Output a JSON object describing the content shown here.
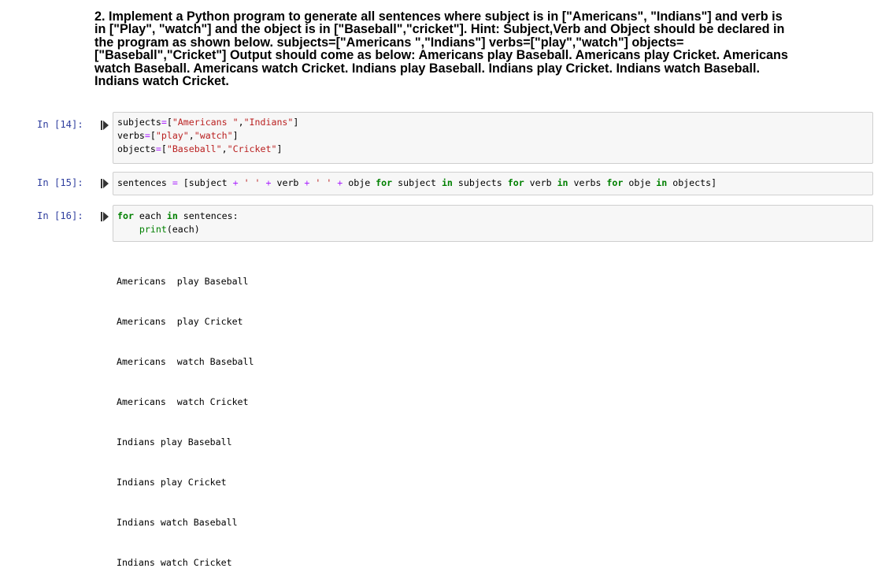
{
  "markdown": {
    "heading": "2. Implement a Python program to generate all sentences where subject is in [\"Americans\", \"Indians\"] and verb is\nin [\"Play\", \"watch\"] and the object is in [\"Baseball\",\"cricket\"]. Hint: Subject,Verb and Object should be declared in\nthe program as shown below. subjects=[\"Americans \",\"Indians\"] verbs=[\"play\",\"watch\"] objects=\n[\"Baseball\",\"Cricket\"] Output should come as below: Americans play Baseball. Americans play Cricket. Americans\nwatch Baseball. Americans watch Cricket. Indians play Baseball. Indians play Cricket. Indians watch Baseball.\nIndians watch Cricket."
  },
  "cells": [
    {
      "prompt": "In [14]:",
      "lines": [
        [
          {
            "t": "subjects",
            "c": ""
          },
          {
            "t": "=",
            "c": "op"
          },
          {
            "t": "[",
            "c": ""
          },
          {
            "t": "\"Americans \"",
            "c": "str"
          },
          {
            "t": ",",
            "c": ""
          },
          {
            "t": "\"Indians\"",
            "c": "str"
          },
          {
            "t": "]",
            "c": ""
          }
        ],
        [
          {
            "t": "verbs",
            "c": ""
          },
          {
            "t": "=",
            "c": "op"
          },
          {
            "t": "[",
            "c": ""
          },
          {
            "t": "\"play\"",
            "c": "str"
          },
          {
            "t": ",",
            "c": ""
          },
          {
            "t": "\"watch\"",
            "c": "str"
          },
          {
            "t": "]",
            "c": ""
          }
        ],
        [
          {
            "t": "objects",
            "c": ""
          },
          {
            "t": "=",
            "c": "op"
          },
          {
            "t": "[",
            "c": ""
          },
          {
            "t": "\"Baseball\"",
            "c": "str"
          },
          {
            "t": ",",
            "c": ""
          },
          {
            "t": "\"Cricket\"",
            "c": "str"
          },
          {
            "t": "]",
            "c": ""
          }
        ]
      ]
    },
    {
      "prompt": "In [15]:",
      "lines": [
        [
          {
            "t": "sentences ",
            "c": ""
          },
          {
            "t": "=",
            "c": "op"
          },
          {
            "t": " [subject ",
            "c": ""
          },
          {
            "t": "+",
            "c": "op"
          },
          {
            "t": " ",
            "c": ""
          },
          {
            "t": "' '",
            "c": "str"
          },
          {
            "t": " ",
            "c": ""
          },
          {
            "t": "+",
            "c": "op"
          },
          {
            "t": " verb ",
            "c": ""
          },
          {
            "t": "+",
            "c": "op"
          },
          {
            "t": " ",
            "c": ""
          },
          {
            "t": "' '",
            "c": "str"
          },
          {
            "t": " ",
            "c": ""
          },
          {
            "t": "+",
            "c": "op"
          },
          {
            "t": " obje ",
            "c": ""
          },
          {
            "t": "for",
            "c": "kw"
          },
          {
            "t": " subject ",
            "c": ""
          },
          {
            "t": "in",
            "c": "kw"
          },
          {
            "t": " subjects ",
            "c": ""
          },
          {
            "t": "for",
            "c": "kw"
          },
          {
            "t": " verb ",
            "c": ""
          },
          {
            "t": "in",
            "c": "kw"
          },
          {
            "t": " verbs ",
            "c": ""
          },
          {
            "t": "for",
            "c": "kw"
          },
          {
            "t": " obje ",
            "c": ""
          },
          {
            "t": "in",
            "c": "kw"
          },
          {
            "t": " objects]",
            "c": ""
          }
        ]
      ]
    },
    {
      "prompt": "In [16]:",
      "lines": [
        [
          {
            "t": "for",
            "c": "kw"
          },
          {
            "t": " each ",
            "c": ""
          },
          {
            "t": "in",
            "c": "kw"
          },
          {
            "t": " sentences:",
            "c": ""
          }
        ],
        [
          {
            "t": "    ",
            "c": ""
          },
          {
            "t": "print",
            "c": "bi"
          },
          {
            "t": "(each)",
            "c": ""
          }
        ]
      ]
    }
  ],
  "output": {
    "lines": [
      "Americans  play Baseball",
      "Americans  play Cricket",
      "Americans  watch Baseball",
      "Americans  watch Cricket",
      "Indians play Baseball",
      "Indians play Cricket",
      "Indians watch Baseball",
      "Indians watch Cricket"
    ]
  },
  "colors": {
    "prompt": "#303f9f",
    "keyword": "#008000",
    "string": "#ba2121",
    "operator": "#aa22ff",
    "cell_background": "#f7f7f7",
    "cell_border": "#cfcfcf"
  },
  "icons": {
    "run": "run-cell-icon"
  }
}
